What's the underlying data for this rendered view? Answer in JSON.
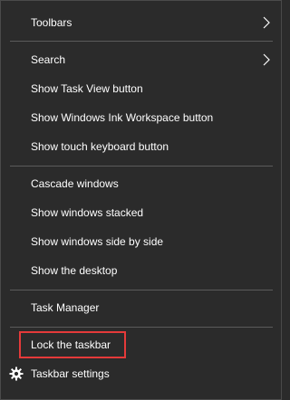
{
  "menu": {
    "toolbars": {
      "label": "Toolbars",
      "has_submenu": true
    },
    "search": {
      "label": "Search",
      "has_submenu": true
    },
    "show_task_view": {
      "label": "Show Task View button"
    },
    "show_ink_workspace": {
      "label": "Show Windows Ink Workspace button"
    },
    "show_touch_keyboard": {
      "label": "Show touch keyboard button"
    },
    "cascade_windows": {
      "label": "Cascade windows"
    },
    "show_windows_stacked": {
      "label": "Show windows stacked"
    },
    "show_windows_side_by_side": {
      "label": "Show windows side by side"
    },
    "show_desktop": {
      "label": "Show the desktop"
    },
    "task_manager": {
      "label": "Task Manager"
    },
    "lock_taskbar": {
      "label": "Lock the taskbar",
      "highlighted": true
    },
    "taskbar_settings": {
      "label": "Taskbar settings",
      "icon": "gear-icon"
    }
  },
  "colors": {
    "background": "#2b2b2b",
    "text": "#ffffff",
    "separator": "#5b5b5b",
    "highlight_border": "#e53a3a"
  }
}
